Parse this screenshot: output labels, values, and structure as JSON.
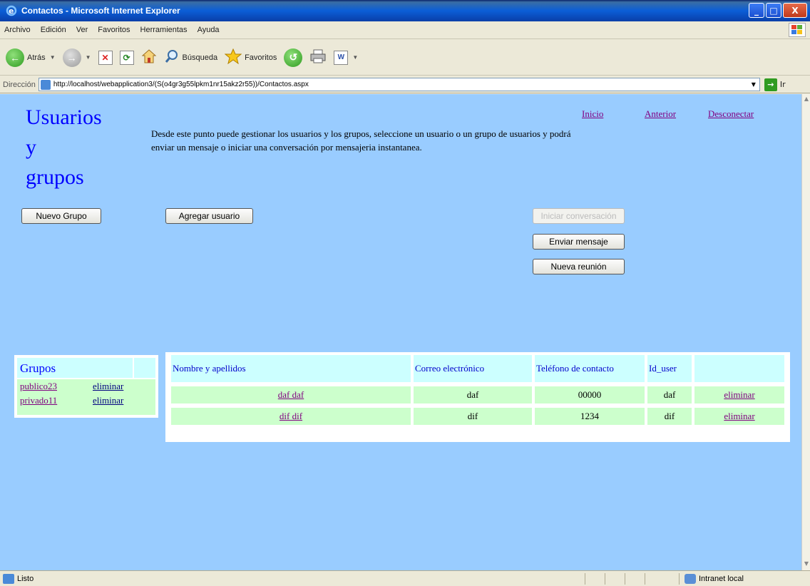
{
  "window": {
    "title": "Contactos - Microsoft Internet Explorer",
    "buttons": {
      "minimize": "_",
      "maximize": "□",
      "close": "X"
    }
  },
  "menu": [
    "Archivo",
    "Edición",
    "Ver",
    "Favoritos",
    "Herramientas",
    "Ayuda"
  ],
  "toolbar": {
    "back": "Atrás",
    "search": "Búsqueda",
    "favorites": "Favoritos"
  },
  "address": {
    "label": "Dirección",
    "url": "http://localhost/webapplication3/(S(o4gr3g55lpkm1nr15akz2r55))/Contactos.aspx",
    "go": "Ir"
  },
  "page": {
    "heading_lines": [
      "Usuarios",
      "y",
      "grupos"
    ],
    "description": "Desde este punto puede gestionar los usuarios y los grupos, seleccione un usuario o un grupo de usuarios y podrá enviar un mensaje o iniciar una conversación por mensajeria instantanea.",
    "nav": {
      "home": "Inicio",
      "back": "Anterior",
      "logout": "Desconectar"
    },
    "buttons": {
      "new_group": "Nuevo Grupo",
      "add_user": "Agregar usuario",
      "start_conversation": "Iniciar conversación",
      "send_message": "Enviar mensaje",
      "new_meeting": "Nueva reunión"
    },
    "groups": {
      "title": "Grupos",
      "rows": [
        {
          "name": "publico23",
          "action": "eliminar"
        },
        {
          "name": "privado11",
          "action": "eliminar"
        }
      ]
    },
    "users": {
      "headers": [
        "Nombre y apellidos",
        "Correo electrónico",
        "Teléfono de contacto",
        "Id_user",
        ""
      ],
      "rows": [
        {
          "name": "daf daf",
          "email": "daf",
          "phone": "00000",
          "id": "daf",
          "action": "eliminar"
        },
        {
          "name": "dif dif",
          "email": "dif",
          "phone": "1234",
          "id": "dif",
          "action": "eliminar"
        }
      ]
    }
  },
  "status": {
    "text": "Listo",
    "zone": "Intranet local"
  }
}
